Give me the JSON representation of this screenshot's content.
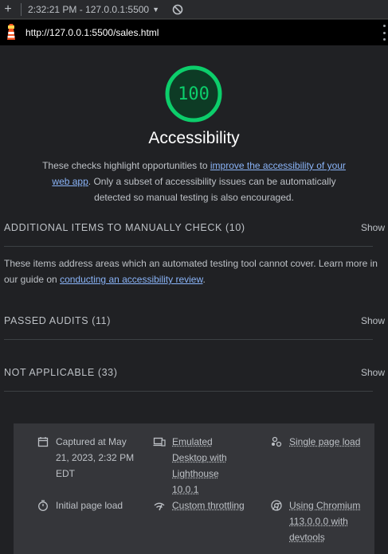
{
  "toolbar": {
    "plus": "+",
    "report_label": "2:32:21 PM - 127.0.0.1:5500",
    "caret": "▼"
  },
  "urlbar": {
    "url": "http://127.0.0.1:5500/sales.html"
  },
  "category": {
    "score": "100",
    "score_fraction": 1.0,
    "score_color": "#0cce6b",
    "title": "Accessibility",
    "desc_before": "These checks highlight opportunities to ",
    "desc_link": "improve the accessibility of your web app",
    "desc_after": ". Only a subset of accessibility issues can be automatically detected so manual testing is also encouraged."
  },
  "groups": [
    {
      "title": "ADDITIONAL ITEMS TO MANUALLY CHECK (10)",
      "action": "Show",
      "desc_before": "These items address areas which an automated testing tool cannot cover. Learn more in our guide on ",
      "desc_link": "conducting an accessibility review",
      "desc_after": "."
    },
    {
      "title": "PASSED AUDITS (11)",
      "action": "Show"
    },
    {
      "title": "NOT APPLICABLE (33)",
      "action": "Show"
    }
  ],
  "runtime": {
    "captured": "Captured at May 21, 2023, 2:32 PM EDT",
    "emulation": "Emulated Desktop with Lighthouse 10.0.1",
    "mode": "Single page load",
    "load_type": "Initial page load",
    "throttling": "Custom throttling",
    "browser": "Using Chromium 113.0.0.0 with devtools"
  },
  "colors": {
    "pass": "#0cce6b",
    "link": "#8ab4f8",
    "background": "#202124"
  }
}
